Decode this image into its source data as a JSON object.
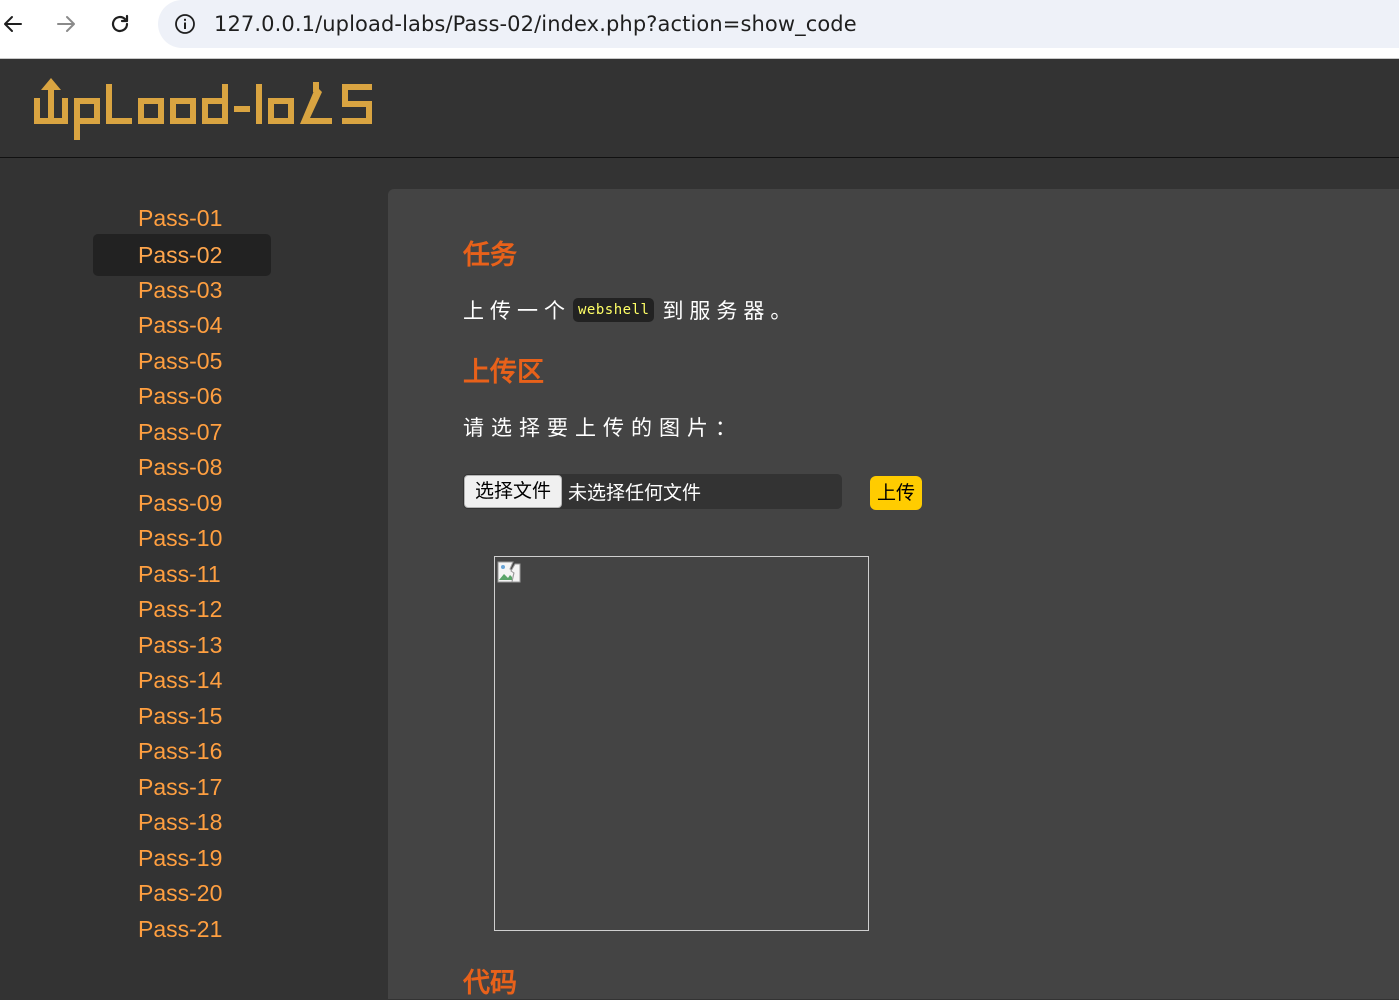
{
  "browser": {
    "url": "127.0.0.1/upload-labs/Pass-02/index.php?action=show_code",
    "back_icon": "arrow-left-icon",
    "forward_icon": "arrow-right-icon",
    "reload_icon": "reload-icon",
    "info_icon": "info-icon"
  },
  "header": {
    "logo_alt": "UpLoad-labs"
  },
  "sidebar": {
    "items": [
      {
        "label": "Pass-01"
      },
      {
        "label": "Pass-02",
        "active": true
      },
      {
        "label": "Pass-03"
      },
      {
        "label": "Pass-04"
      },
      {
        "label": "Pass-05"
      },
      {
        "label": "Pass-06"
      },
      {
        "label": "Pass-07"
      },
      {
        "label": "Pass-08"
      },
      {
        "label": "Pass-09"
      },
      {
        "label": "Pass-10"
      },
      {
        "label": "Pass-11"
      },
      {
        "label": "Pass-12"
      },
      {
        "label": "Pass-13"
      },
      {
        "label": "Pass-14"
      },
      {
        "label": "Pass-15"
      },
      {
        "label": "Pass-16"
      },
      {
        "label": "Pass-17"
      },
      {
        "label": "Pass-18"
      },
      {
        "label": "Pass-19"
      },
      {
        "label": "Pass-20"
      },
      {
        "label": "Pass-21"
      }
    ]
  },
  "main": {
    "task_title": "任务",
    "task_prefix": "上传一个",
    "task_code": "webshell",
    "task_suffix": "到服务器。",
    "upload_title": "上传区",
    "prompt": "请选择要上传的图片：",
    "choose_file_label": "选择文件",
    "no_file_label": "未选择任何文件",
    "upload_label": "上传",
    "code_title": "代码"
  },
  "colors": {
    "accent": "#ff9f40",
    "heading": "#e8611a",
    "upload_button": "#ffcc00",
    "code_text": "#ffff66",
    "logo": "#d9a441"
  }
}
